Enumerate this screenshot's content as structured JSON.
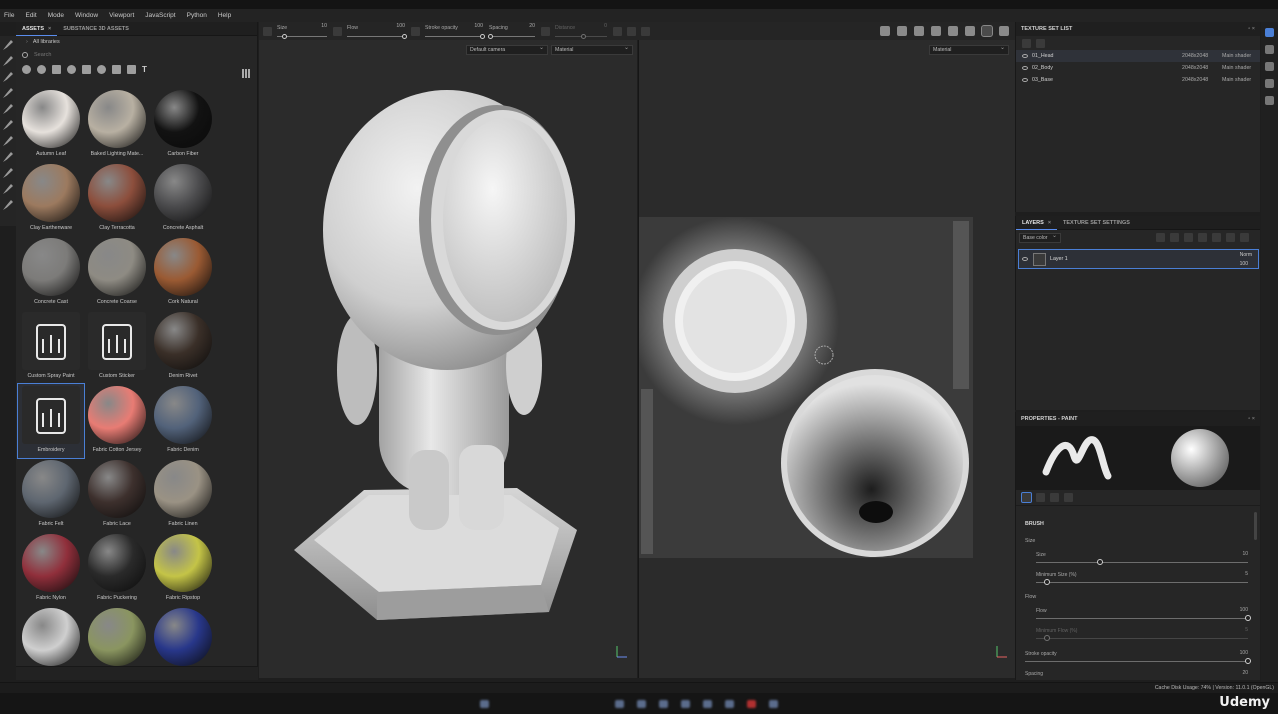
{
  "menu": [
    "File",
    "Edit",
    "Mode",
    "Window",
    "Viewport",
    "JavaScript",
    "Python",
    "Help"
  ],
  "assets_panel": {
    "tabs": [
      {
        "label": "ASSETS",
        "closable": "×"
      },
      {
        "label": "SUBSTANCE 3D ASSETS"
      }
    ],
    "library_path": "All libraries",
    "search_placeholder": "Search",
    "items": [
      {
        "label": "Autumn Leaf",
        "color": "#e6e1dc"
      },
      {
        "label": "Baked Lighting Mate...",
        "color": "#b8b0a2"
      },
      {
        "label": "Carbon Fiber",
        "color": "#121212"
      },
      {
        "label": "Clay Earthenware",
        "color": "#9c7a5f"
      },
      {
        "label": "Clay Terracotta",
        "color": "#8c4e3c"
      },
      {
        "label": "Concrete Asphalt",
        "color": "#4b4b4d"
      },
      {
        "label": "Concrete Cast",
        "color": "#7c7b79"
      },
      {
        "label": "Concrete Coarse",
        "color": "#8e8b83"
      },
      {
        "label": "Cork Natural",
        "color": "#9a5a33"
      },
      {
        "label": "Custom Spray Paint",
        "color": "#2c2c2c",
        "icon": "spray-paint-icon"
      },
      {
        "label": "Custom Sticker",
        "color": "#2c2c2c",
        "icon": "sticker-icon"
      },
      {
        "label": "Denim Rivet",
        "color": "#3a2f28"
      },
      {
        "label": "Embroidery",
        "color": "#2c2c2c",
        "icon": "embroidery-icon",
        "selected": true
      },
      {
        "label": "Fabric Cotton Jersey",
        "color": "#e87c74"
      },
      {
        "label": "Fabric Denim",
        "color": "#52627a"
      },
      {
        "label": "Fabric Felt",
        "color": "#5e6670"
      },
      {
        "label": "Fabric Lace",
        "color": "#3d302d"
      },
      {
        "label": "Fabric Linen",
        "color": "#9a9284"
      },
      {
        "label": "Fabric Nylon",
        "color": "#902f3b"
      },
      {
        "label": "Fabric Puckering",
        "color": "#2a2a2a"
      },
      {
        "label": "Fabric Ripstop",
        "color": "#c4c447"
      },
      {
        "label": "",
        "color": "#cfcfcf"
      },
      {
        "label": "",
        "color": "#8a9560"
      },
      {
        "label": "",
        "color": "#28378a"
      }
    ]
  },
  "toolbar": {
    "size": {
      "label": "Size",
      "value": "10",
      "fraction": 0.15
    },
    "flow": {
      "label": "Flow",
      "value": "100",
      "fraction": 1.0
    },
    "stroke_opacity": {
      "label": "Stroke opacity",
      "value": "100",
      "fraction": 1.0
    },
    "spacing": {
      "label": "Spacing",
      "value": "20",
      "fraction": 0.05
    },
    "distance": {
      "label": "Distance",
      "value": "0",
      "fraction": 0.55
    }
  },
  "viewport": {
    "camera_select": "Default camera",
    "mode_left": "Material",
    "mode_right": "Material"
  },
  "texture_set_list": {
    "title": "TEXTURE SET LIST",
    "rows": [
      {
        "name": "01_Head",
        "res": "2048x2048",
        "shader": "Main shader",
        "selected": true
      },
      {
        "name": "02_Body",
        "res": "2048x2048",
        "shader": "Main shader"
      },
      {
        "name": "03_Base",
        "res": "2048x2048",
        "shader": "Main shader"
      }
    ]
  },
  "layers": {
    "tabs": [
      {
        "label": "LAYERS",
        "close": "×"
      },
      {
        "label": "TEXTURE SET SETTINGS"
      }
    ],
    "channel": "Base color",
    "layer_name": "Layer 1",
    "blend": "Norm",
    "opacity": "100"
  },
  "properties": {
    "title": "PROPERTIES - PAINT",
    "section": "BRUSH",
    "size_group": "Size",
    "flow_group": "Flow",
    "rows": {
      "size": {
        "label": "Size",
        "value": "10",
        "fraction": 0.3
      },
      "min_size": {
        "label": "Minimum Size (%)",
        "value": "5",
        "fraction": 0.05
      },
      "flow": {
        "label": "Flow",
        "value": "100",
        "fraction": 1.0
      },
      "min_flow": {
        "label": "Minimum Flow (%)",
        "value": "5",
        "fraction": 0.05
      },
      "stroke_opacity": {
        "label": "Stroke opacity",
        "value": "100",
        "fraction": 1.0
      },
      "spacing": {
        "label": "Spacing",
        "value": "20",
        "fraction": 0.05
      }
    }
  },
  "status": {
    "cache": "Cache Disk Usage:  74%  |  Version: 11.0.1 (OpenGL)"
  },
  "watermark": "Udemy"
}
